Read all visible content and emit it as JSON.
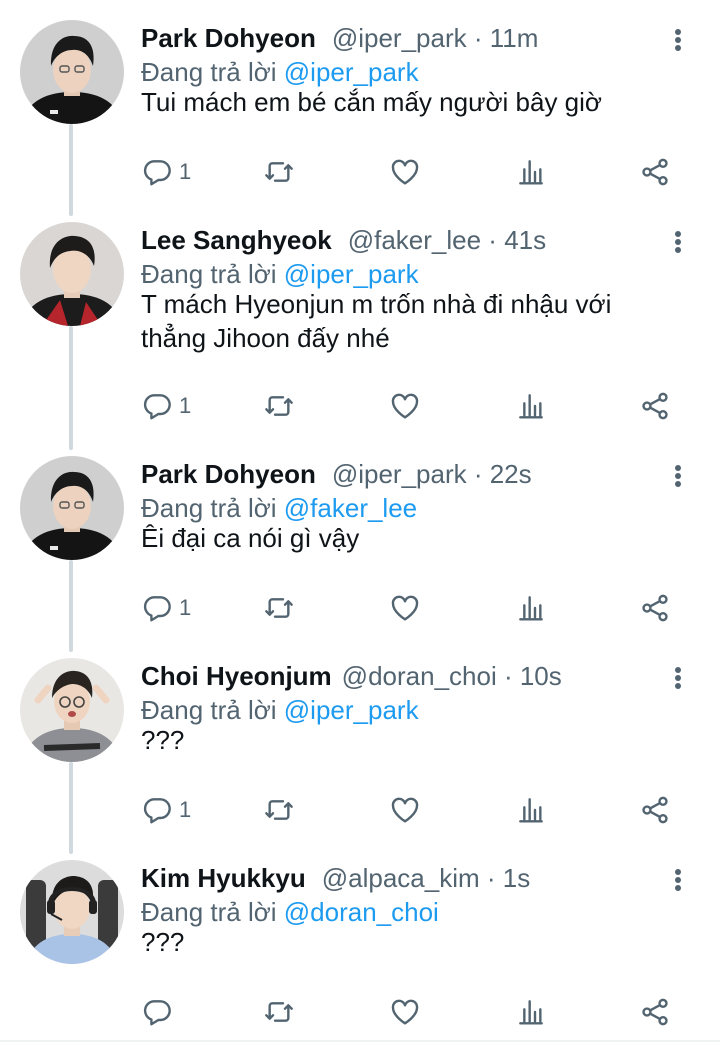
{
  "tweets": [
    {
      "name": "Park Dohyeon",
      "meta": "@iper_park · 11m",
      "reply_prefix": "Đang trả lời ",
      "reply_to": "@iper_park",
      "text": "Tui mách em bé cắn mấy người bây giờ",
      "reply_count": "1",
      "avatar_icon": "avatar-dark-hair-black-jacket"
    },
    {
      "name": "Lee Sanghyeok",
      "meta": "@faker_lee · 41s",
      "reply_prefix": "Đang trả lời ",
      "reply_to": "@iper_park",
      "text": "T mách Hyeonjun m trốn nhà đi nhậu với thẳng Jihoon đấy nhé",
      "reply_count": "1",
      "avatar_icon": "avatar-dark-hair-red-jacket"
    },
    {
      "name": "Park Dohyeon",
      "meta": "@iper_park · 22s",
      "reply_prefix": "Đang trả lời ",
      "reply_to": "@faker_lee",
      "text": "Êi đại ca nói gì vậy",
      "reply_count": "1",
      "avatar_icon": "avatar-dark-hair-black-jacket"
    },
    {
      "name": "Choi Hyeonjum",
      "meta": "@doran_choi · 10s",
      "reply_prefix": "Đang trả lời ",
      "reply_to": "@iper_park",
      "text": "???",
      "reply_count": "1",
      "avatar_icon": "avatar-glasses-grey-hoodie"
    },
    {
      "name": "Kim Hyukkyu",
      "meta": "@alpaca_kim · 1s",
      "reply_prefix": "Đang trả lời ",
      "reply_to": "@doran_choi",
      "text": "???",
      "reply_count": "",
      "avatar_icon": "avatar-headset-blue-shirt"
    }
  ],
  "icons": {
    "reply": "reply-icon",
    "retweet": "retweet-icon",
    "like": "heart-icon",
    "views": "views-icon",
    "share": "share-icon",
    "more": "more-icon"
  },
  "colors": {
    "text": "#0f1419",
    "muted": "#536471",
    "link": "#1d9bf0",
    "thread_line": "#cfd9de"
  }
}
